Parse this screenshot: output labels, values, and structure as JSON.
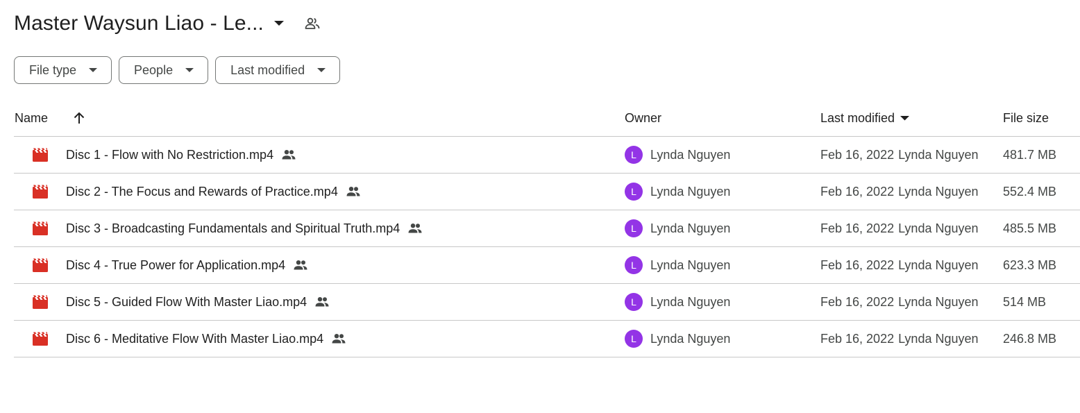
{
  "header": {
    "folder_title": "Master Waysun Liao - Le...",
    "icons": {
      "caret": "arrow-drop-down-icon",
      "shared": "shared-people-icon"
    }
  },
  "filters": [
    {
      "label": "File type"
    },
    {
      "label": "People"
    },
    {
      "label": "Last modified"
    }
  ],
  "table": {
    "columns": {
      "name": "Name",
      "owner": "Owner",
      "last_modified": "Last modified",
      "file_size": "File size"
    },
    "rows": [
      {
        "name": "Disc 1 - Flow with No Restriction.mp4",
        "owner": "Lynda Nguyen",
        "owner_initial": "L",
        "modified_date": "Feb 16, 2022",
        "modified_by": "Lynda Nguyen",
        "size": "481.7 MB"
      },
      {
        "name": "Disc 2 - The Focus and Rewards of Practice.mp4",
        "owner": "Lynda Nguyen",
        "owner_initial": "L",
        "modified_date": "Feb 16, 2022",
        "modified_by": "Lynda Nguyen",
        "size": "552.4 MB"
      },
      {
        "name": "Disc 3 - Broadcasting Fundamentals and Spiritual Truth.mp4",
        "owner": "Lynda Nguyen",
        "owner_initial": "L",
        "modified_date": "Feb 16, 2022",
        "modified_by": "Lynda Nguyen",
        "size": "485.5 MB"
      },
      {
        "name": "Disc 4 - True Power for Application.mp4",
        "owner": "Lynda Nguyen",
        "owner_initial": "L",
        "modified_date": "Feb 16, 2022",
        "modified_by": "Lynda Nguyen",
        "size": "623.3 MB"
      },
      {
        "name": "Disc 5 - Guided Flow With Master Liao.mp4",
        "owner": "Lynda Nguyen",
        "owner_initial": "L",
        "modified_date": "Feb 16, 2022",
        "modified_by": "Lynda Nguyen",
        "size": "514 MB"
      },
      {
        "name": "Disc 6 - Meditative Flow With Master Liao.mp4",
        "owner": "Lynda Nguyen",
        "owner_initial": "L",
        "modified_date": "Feb 16, 2022",
        "modified_by": "Lynda Nguyen",
        "size": "246.8 MB"
      }
    ]
  },
  "colors": {
    "video_icon": "#d93025",
    "avatar": "#9334e6",
    "text_primary": "#1f1f1f",
    "text_secondary": "#444746",
    "divider": "#c7c7c7"
  }
}
